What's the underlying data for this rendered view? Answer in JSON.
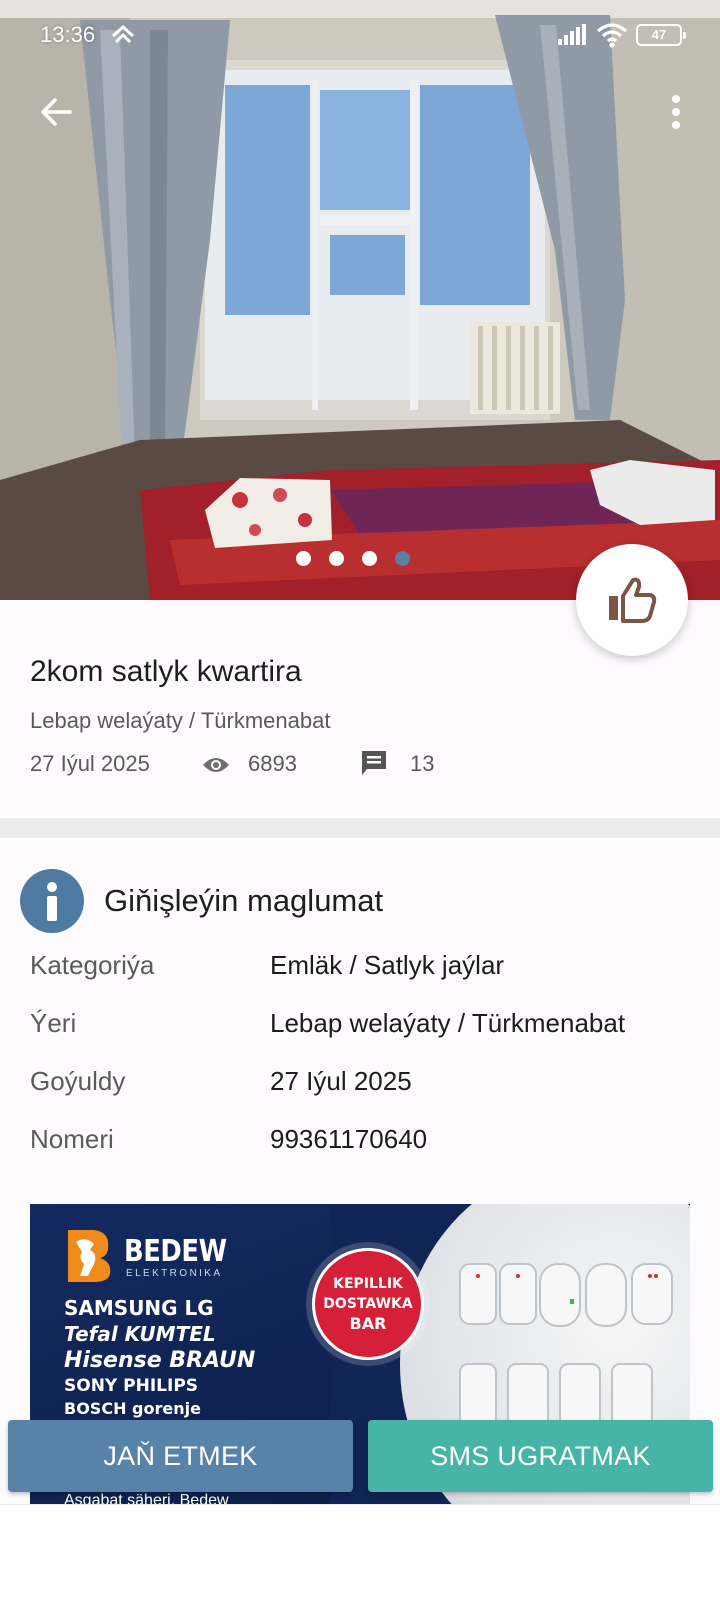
{
  "status_bar": {
    "time": "13:36",
    "battery": "47"
  },
  "listing": {
    "title": "2kom satlyk kwartira",
    "location": "Lebap welaýaty / Türkmenabat",
    "date": "27 Iýul 2025",
    "views": "6893",
    "comments": "13",
    "gallery": {
      "image_count": 4,
      "active_index": 3
    }
  },
  "details": {
    "heading": "Giňişleýin maglumat",
    "rows": [
      {
        "key": "Kategoriýa",
        "value": "Emläk / Satlyk jaýlar"
      },
      {
        "key": "Ýeri",
        "value": "Lebap welaýaty / Türkmenabat"
      },
      {
        "key": "Goýuldy",
        "value": "27 Iýul 2025"
      },
      {
        "key": "Nomeri",
        "value": "99361170640"
      }
    ]
  },
  "ad": {
    "brand": "BEDEW",
    "brand_sub": "ELEKTRONIKA",
    "line1": "SAMSUNG  LG",
    "line2": "Tefal KUMTEL",
    "line3": "Hisense BRAUN",
    "line4": "SONY PHILIPS",
    "line5": "BOSCH gorenje",
    "badge_line1": "KEPILLIK",
    "badge_line2": "DOSTAWKA",
    "badge_line3": "BAR",
    "address": "Aşgabat şäheri, Bedew"
  },
  "actions": {
    "call": "JAŇ ETMEK",
    "sms": "SMS UGRATMAK"
  },
  "colors": {
    "primary": "#5882a8",
    "accent": "#46b4a6",
    "info_icon": "#4f7ba3",
    "badge_red": "#d6203a"
  },
  "icons": {
    "back": "arrow-left-icon",
    "more": "more-vertical-icon",
    "like": "thumb-up-icon",
    "views": "eye-icon",
    "comments": "comment-icon",
    "info": "info-icon"
  }
}
